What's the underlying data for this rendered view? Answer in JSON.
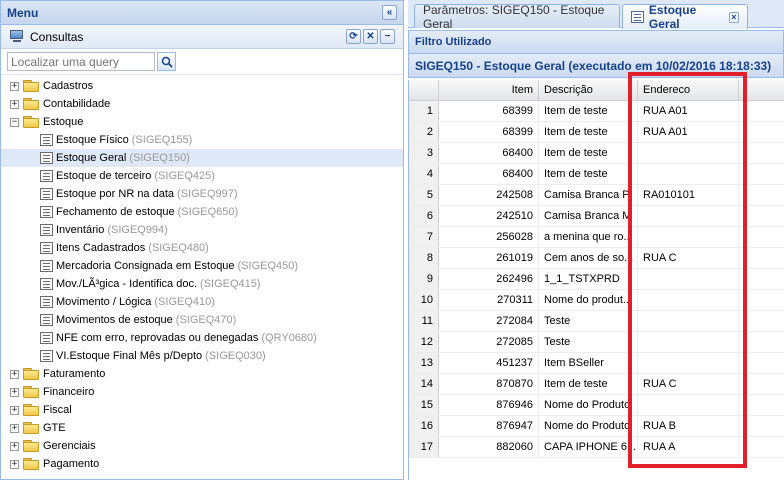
{
  "menu": {
    "title": "Menu",
    "collapse_icon": "double-chevron-left-icon",
    "consultas_title": "Consultas",
    "search_placeholder": "Localizar uma query",
    "tree": [
      {
        "type": "folder",
        "label": "Cadastros",
        "expanded": false
      },
      {
        "type": "folder",
        "label": "Contabilidade",
        "expanded": false
      },
      {
        "type": "folder",
        "label": "Estoque",
        "expanded": true
      },
      {
        "type": "leaf",
        "label": "Estoque Físico",
        "code": "(SIGEQ155)"
      },
      {
        "type": "leaf",
        "label": "Estoque Geral",
        "code": "(SIGEQ150)",
        "selected": true
      },
      {
        "type": "leaf",
        "label": "Estoque de terceiro",
        "code": "(SIGEQ425)"
      },
      {
        "type": "leaf",
        "label": "Estoque por NR na data",
        "code": "(SIGEQ997)"
      },
      {
        "type": "leaf",
        "label": "Fechamento de estoque",
        "code": "(SIGEQ650)"
      },
      {
        "type": "leaf",
        "label": "Inventário",
        "code": "(SIGEQ994)"
      },
      {
        "type": "leaf",
        "label": "Itens Cadastrados",
        "code": "(SIGEQ480)"
      },
      {
        "type": "leaf",
        "label": "Mercadoria Consignada em Estoque",
        "code": "(SIGEQ450)"
      },
      {
        "type": "leaf",
        "label": "Mov./LÃ³gica - Identifica doc.",
        "code": "(SIGEQ415)"
      },
      {
        "type": "leaf",
        "label": "Movimento / Lógica",
        "code": "(SIGEQ410)"
      },
      {
        "type": "leaf",
        "label": "Movimentos de estoque",
        "code": "(SIGEQ470)"
      },
      {
        "type": "leaf",
        "label": "NFE com erro, reprovadas ou denegadas",
        "code": "(QRY0680)"
      },
      {
        "type": "leaf",
        "label": "VI.Estoque Final Mês p/Depto",
        "code": "(SIGEQ030)"
      },
      {
        "type": "folder",
        "label": "Faturamento",
        "expanded": false
      },
      {
        "type": "folder",
        "label": "Financeiro",
        "expanded": false
      },
      {
        "type": "folder",
        "label": "Fiscal",
        "expanded": false
      },
      {
        "type": "folder",
        "label": "GTE",
        "expanded": false
      },
      {
        "type": "folder",
        "label": "Gerenciais",
        "expanded": false
      },
      {
        "type": "folder",
        "label": "Pagamento",
        "expanded": false
      }
    ]
  },
  "tabs": [
    {
      "label": "Parâmetros: SIGEQ150 - Estoque Geral",
      "active": false
    },
    {
      "label": "Estoque Geral",
      "active": true,
      "closable": true
    }
  ],
  "filter_label": "Filtro Utilizado",
  "report_title": "SIGEQ150 - Estoque Geral (executado em 10/02/2016 18:18:33)",
  "grid": {
    "columns": [
      "Item",
      "Descrição",
      "Endereco"
    ],
    "rows": [
      {
        "n": "1",
        "item": "68399",
        "desc": "Item de teste",
        "end": "RUA A01"
      },
      {
        "n": "2",
        "item": "68399",
        "desc": "Item de teste",
        "end": "RUA A01"
      },
      {
        "n": "3",
        "item": "68400",
        "desc": "Item de teste",
        "end": ""
      },
      {
        "n": "4",
        "item": "68400",
        "desc": "Item de teste",
        "end": ""
      },
      {
        "n": "5",
        "item": "242508",
        "desc": "Camisa Branca P",
        "end": "RA010101"
      },
      {
        "n": "6",
        "item": "242510",
        "desc": "Camisa Branca M",
        "end": ""
      },
      {
        "n": "7",
        "item": "256028",
        "desc": "a menina que ro...",
        "end": ""
      },
      {
        "n": "8",
        "item": "261019",
        "desc": "Cem anos de so...",
        "end": "RUA C"
      },
      {
        "n": "9",
        "item": "262496",
        "desc": "1_1_TSTXPRD",
        "end": ""
      },
      {
        "n": "10",
        "item": "270311",
        "desc": "Nome do produt...",
        "end": ""
      },
      {
        "n": "11",
        "item": "272084",
        "desc": "Teste",
        "end": ""
      },
      {
        "n": "12",
        "item": "272085",
        "desc": "Teste",
        "end": ""
      },
      {
        "n": "13",
        "item": "451237",
        "desc": "Item BSeller",
        "end": ""
      },
      {
        "n": "14",
        "item": "870870",
        "desc": "Item de teste",
        "end": "RUA C"
      },
      {
        "n": "15",
        "item": "876946",
        "desc": "Nome do Produto",
        "end": ""
      },
      {
        "n": "16",
        "item": "876947",
        "desc": "Nome do Produto",
        "end": "RUA B"
      },
      {
        "n": "17",
        "item": "882060",
        "desc": "CAPA IPHONE 6...",
        "end": "RUA A"
      }
    ]
  },
  "colors": {
    "highlight": "#e2202a",
    "header_text": "#15428b",
    "panel_border": "#99bbe8",
    "selected_row": "#dfe8f6"
  }
}
